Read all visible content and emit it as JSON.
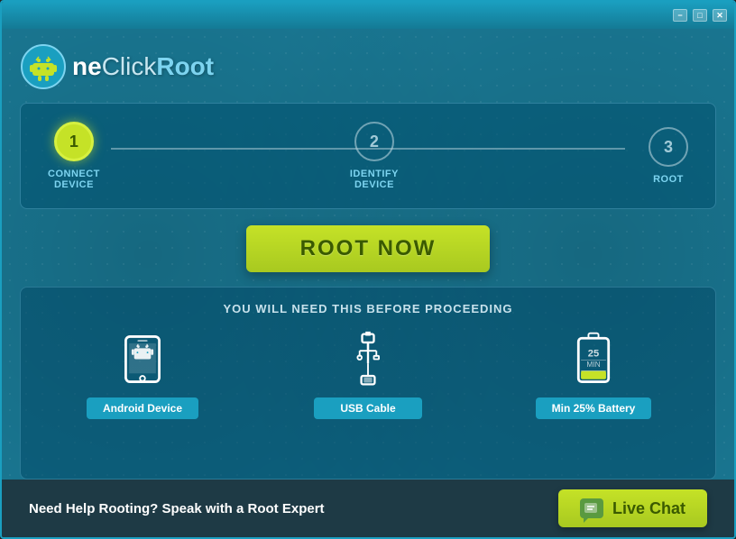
{
  "window": {
    "title": "OneClickRoot",
    "controls": {
      "minimize": "−",
      "maximize": "□",
      "close": "✕"
    }
  },
  "logo": {
    "text_one": "ne",
    "text_click": "Click",
    "text_root": "Root"
  },
  "steps": {
    "items": [
      {
        "number": "1",
        "label": "CONNECT\nDEVICE",
        "active": true
      },
      {
        "number": "2",
        "label": "IDENTIFY\nDEVICE",
        "active": false
      },
      {
        "number": "3",
        "label": "ROOT",
        "active": false
      }
    ]
  },
  "root_button": {
    "label": "ROOT NOW"
  },
  "requirements": {
    "title": "YOU WILL NEED THIS BEFORE PROCEEDING",
    "items": [
      {
        "name": "Android Device",
        "icon": "android"
      },
      {
        "name": "USB Cable",
        "icon": "usb"
      },
      {
        "name": "Min 25% Battery",
        "icon": "battery"
      }
    ]
  },
  "bottom": {
    "help_text": "Need Help Rooting? Speak with a Root Expert",
    "live_chat_label": "Live Chat"
  }
}
